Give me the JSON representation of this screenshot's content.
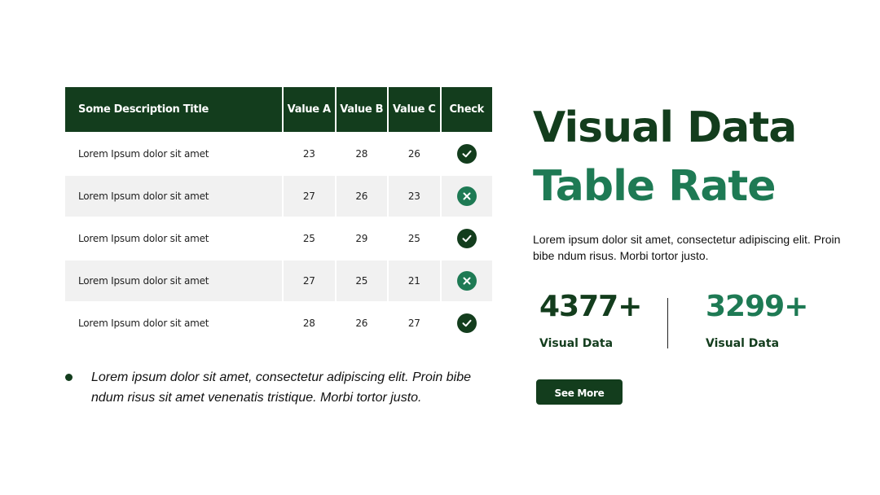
{
  "table": {
    "headers": [
      "Some Description Title",
      "Value A",
      "Value B",
      "Value C",
      "Check"
    ],
    "rows": [
      {
        "label": "Lorem Ipsum dolor sit amet",
        "a": "23",
        "b": "28",
        "c": "26",
        "check": "check-icon"
      },
      {
        "label": "Lorem Ipsum dolor sit amet",
        "a": "27",
        "b": "26",
        "c": "23",
        "check": "x-icon"
      },
      {
        "label": "Lorem Ipsum dolor sit amet",
        "a": "25",
        "b": "29",
        "c": "25",
        "check": "check-icon"
      },
      {
        "label": "Lorem Ipsum dolor sit amet",
        "a": "27",
        "b": "25",
        "c": "21",
        "check": "x-icon"
      },
      {
        "label": "Lorem Ipsum dolor sit amet",
        "a": "28",
        "b": "26",
        "c": "27",
        "check": "check-icon"
      }
    ]
  },
  "note": "Lorem ipsum dolor sit amet, consectetur adipiscing elit. Proin bibe ndum risus sit amet venenatis tristique. Morbi tortor justo.",
  "heading": {
    "line1": "Visual Data",
    "line2": "Table Rate"
  },
  "description": "Lorem ipsum dolor sit amet, consectetur adipiscing elit. Proin bibe ndum risus. Morbi tortor justo.",
  "stats": [
    {
      "value": "4377+",
      "label": "Visual Data"
    },
    {
      "value": "3299+",
      "label": "Visual Data"
    }
  ],
  "button_label": "See More",
  "colors": {
    "dark_green": "#133d1d",
    "accent_green": "#1e7a54",
    "row_alt": "#f1f1f1"
  }
}
